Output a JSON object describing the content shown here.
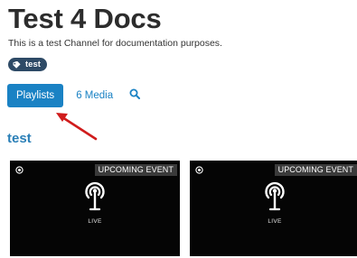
{
  "channel": {
    "title": "Test 4 Docs",
    "description": "This is a test Channel for documentation purposes.",
    "tag": "test"
  },
  "tabs": {
    "playlists": "Playlists",
    "media": "6 Media"
  },
  "section": {
    "heading": "test"
  },
  "cards": [
    {
      "badge": "UPCOMING EVENT",
      "live_label": "LIVE"
    },
    {
      "badge": "UPCOMING EVENT",
      "live_label": "LIVE"
    }
  ],
  "colors": {
    "accent": "#1a82c4",
    "heading": "#2a7fb7",
    "tag_bg": "#2e4a66",
    "annotation_arrow": "#d01c1c",
    "card_bg": "#050505"
  },
  "icons": {
    "tag": "tag-icon",
    "search": "search-icon",
    "card_corner": "record-icon",
    "live": "live-broadcast-icon"
  }
}
